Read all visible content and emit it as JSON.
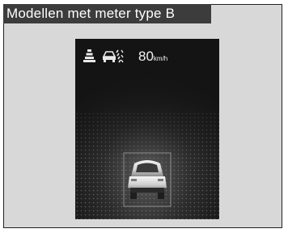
{
  "header": {
    "title": "Modellen met meter type B"
  },
  "display": {
    "speed": "80",
    "unit": "km/h",
    "icons": [
      "lane-keeping-icon",
      "road-departure-icon"
    ],
    "vehicle": "car-rear-icon"
  },
  "colors": {
    "panel_background": "#d8d8d8",
    "header_background": "#3c3c3c",
    "screen_background": "#141414",
    "text": "#f2f2f2"
  }
}
